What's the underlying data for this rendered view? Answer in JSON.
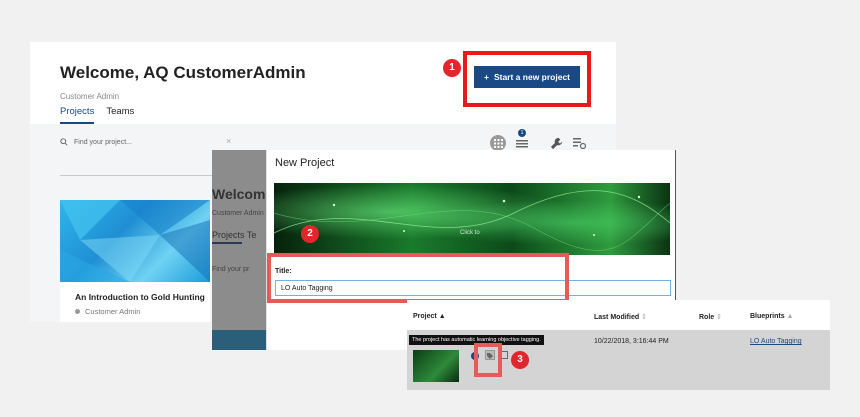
{
  "dashboard": {
    "welcome": "Welcome, AQ CustomerAdmin",
    "role": "Customer Admin",
    "tabs": [
      {
        "label": "Projects"
      },
      {
        "label": "Teams"
      }
    ],
    "search_placeholder": "Find your project...",
    "search_clear": "×",
    "list_badge": "1",
    "start_button": "Start a new project",
    "start_button_icon": "+",
    "card": {
      "title": "An Introduction to Gold Hunting",
      "owner": "Customer Admin"
    }
  },
  "dim_overlay": {
    "welcome": "Welcome",
    "role": "Customer Admin",
    "tabs": "Projects   Te",
    "search": "Find your pr"
  },
  "modal": {
    "title": "New Project",
    "image_caption": "Click to",
    "title_label": "Title:",
    "title_value": "LO Auto Tagging"
  },
  "table": {
    "headers": {
      "project": "Project",
      "last_modified": "Last Modified",
      "role": "Role",
      "blueprints": "Blueprints"
    },
    "sort_up": "▲",
    "sort_both": "⇕",
    "row": {
      "tooltip": "The project has automatic learning objective tagging.",
      "last_modified": "10/22/2018, 3:16:44 PM",
      "blueprint": "LO Auto Tagging",
      "info": "i"
    }
  },
  "steps": [
    "1",
    "2",
    "3"
  ],
  "colors": {
    "brand": "#1a4a86",
    "callout_red": "#e8181c",
    "step_red": "#e3262b"
  }
}
